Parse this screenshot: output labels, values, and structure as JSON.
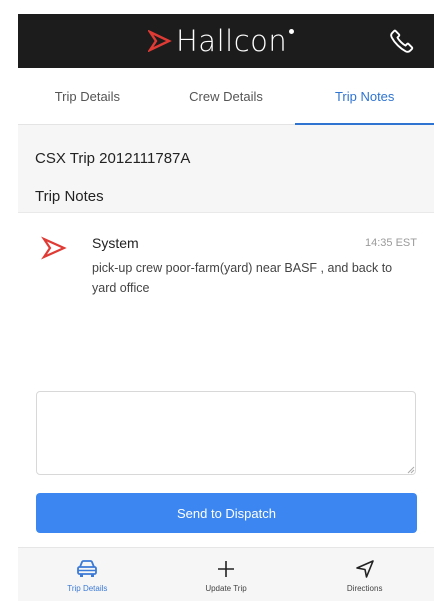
{
  "header": {
    "brand_name": "Hallcon",
    "logo_color": "#e03a34",
    "phone_icon": "phone-icon"
  },
  "tabs": [
    {
      "label": "Trip Details",
      "active": false
    },
    {
      "label": "Crew Details",
      "active": false
    },
    {
      "label": "Trip Notes",
      "active": true
    }
  ],
  "trip": {
    "title": "CSX Trip 2012111787A",
    "notes_heading": "Trip Notes"
  },
  "notes": [
    {
      "sender": "System",
      "time": "14:35 EST",
      "body": "pick-up crew poor-farm(yard) near BASF , and back to yard office",
      "icon": "hallcon-logo-icon"
    }
  ],
  "compose": {
    "value": "",
    "placeholder": "",
    "send_label": "Send to Dispatch"
  },
  "bottom_nav": [
    {
      "label": "Trip Details",
      "icon": "car-icon",
      "active": true
    },
    {
      "label": "Update Trip",
      "icon": "plus-icon",
      "active": false
    },
    {
      "label": "Directions",
      "icon": "navigation-arrow-icon",
      "active": false
    }
  ],
  "colors": {
    "accent": "#3b86f0",
    "active_tab": "#2f74d0",
    "header_bg": "#1c1c1c",
    "brand_red": "#e03a34"
  }
}
